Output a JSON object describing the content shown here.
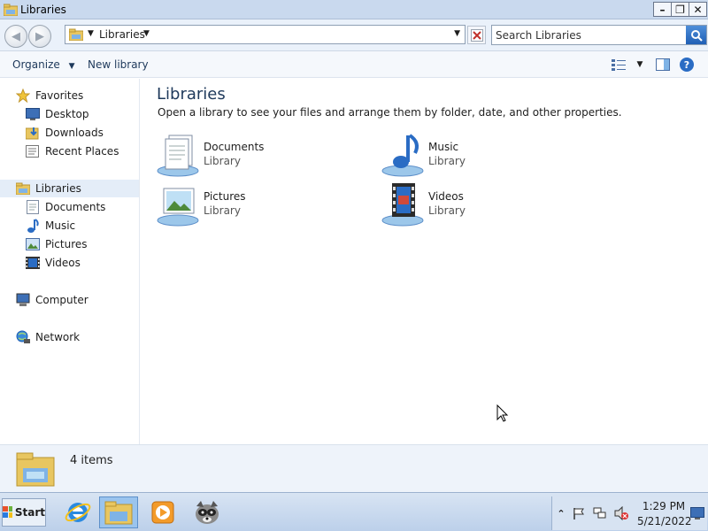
{
  "window": {
    "title": "Libraries",
    "minimize_label": "–",
    "maximize_label": "❐",
    "close_label": "✕"
  },
  "address": {
    "crumb": "Libraries",
    "search_placeholder": "Search Libraries"
  },
  "toolbar": {
    "organize_label": "Organize",
    "new_library_label": "New library"
  },
  "sidebar": {
    "favorites": {
      "label": "Favorites",
      "items": [
        {
          "label": "Desktop",
          "icon": "desktop-icon"
        },
        {
          "label": "Downloads",
          "icon": "downloads-icon"
        },
        {
          "label": "Recent Places",
          "icon": "recent-places-icon"
        }
      ]
    },
    "libraries": {
      "label": "Libraries",
      "items": [
        {
          "label": "Documents",
          "icon": "documents-icon"
        },
        {
          "label": "Music",
          "icon": "music-icon"
        },
        {
          "label": "Pictures",
          "icon": "pictures-icon"
        },
        {
          "label": "Videos",
          "icon": "videos-icon"
        }
      ]
    },
    "computer": {
      "label": "Computer"
    },
    "network": {
      "label": "Network"
    }
  },
  "main": {
    "heading": "Libraries",
    "description": "Open a library to see your files and arrange them by folder, date, and other properties.",
    "libraries": [
      {
        "name": "Documents",
        "type": "Library",
        "icon": "documents-library-icon"
      },
      {
        "name": "Music",
        "type": "Library",
        "icon": "music-library-icon"
      },
      {
        "name": "Pictures",
        "type": "Library",
        "icon": "pictures-library-icon"
      },
      {
        "name": "Videos",
        "type": "Library",
        "icon": "videos-library-icon"
      }
    ]
  },
  "details": {
    "item_count": "4 items"
  },
  "taskbar": {
    "start_label": "Start",
    "apps": [
      "internet-explorer-icon",
      "windows-explorer-icon",
      "media-player-icon",
      "raccoon-app-icon"
    ],
    "clock_time": "1:29 PM",
    "clock_date": "5/21/2022"
  },
  "colors": {
    "accent": "#1e395b",
    "titlebar": "#c9d9ee",
    "selection": "#e4edf8"
  }
}
